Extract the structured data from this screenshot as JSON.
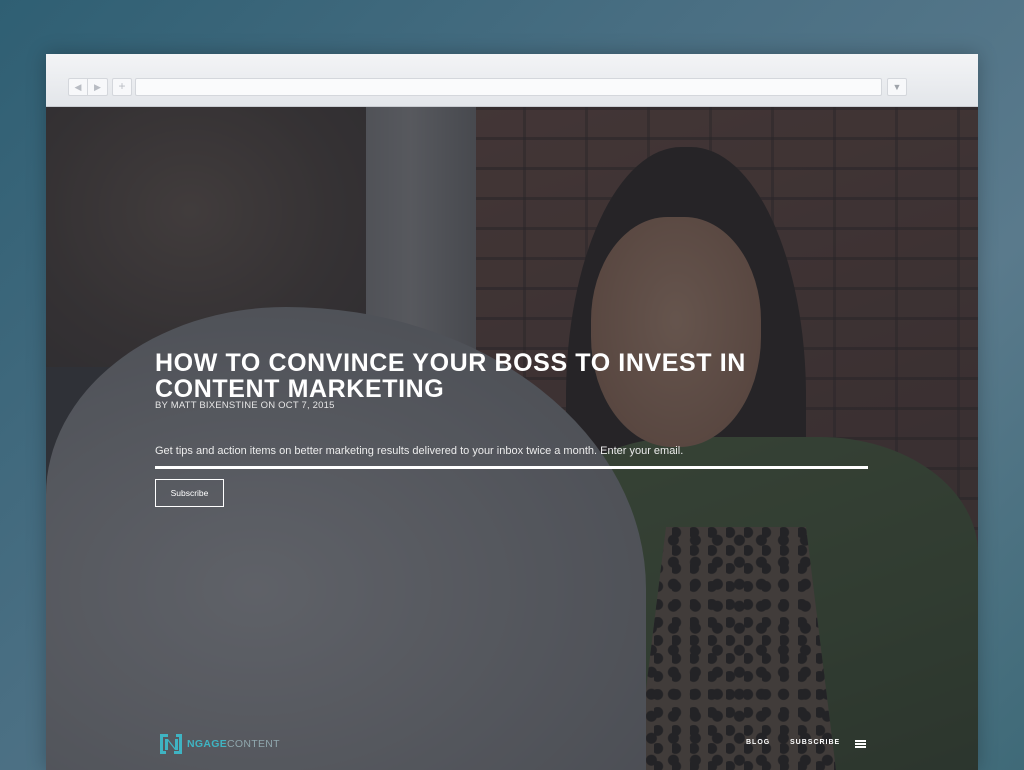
{
  "browser": {
    "back_glyph": "◀",
    "forward_glyph": "▶",
    "newtab_glyph": "+",
    "url": "",
    "menu_glyph": "▼"
  },
  "hero": {
    "title": "HOW TO CONVINCE YOUR BOSS TO INVEST IN CONTENT MARKETING",
    "byline": "BY MATT BIXENSTINE ON OCT 7, 2015",
    "tagline": "Get tips and action items on better marketing results delivered to your inbox twice a month. Enter your email.",
    "email_placeholder": "",
    "subscribe_label": "Subscribe"
  },
  "footer": {
    "logo_part1": "NGAGE",
    "logo_part2": "CONTENT",
    "nav": {
      "blog": "BLOG",
      "subscribe": "SUBSCRIBE"
    }
  },
  "colors": {
    "logo_accent": "#3fb4c3",
    "logo_secondary": "#8fa7ad",
    "overlay": "#282a30"
  },
  "icons": {
    "menu": "hamburger-icon",
    "logo": "ngage-logo-icon"
  }
}
